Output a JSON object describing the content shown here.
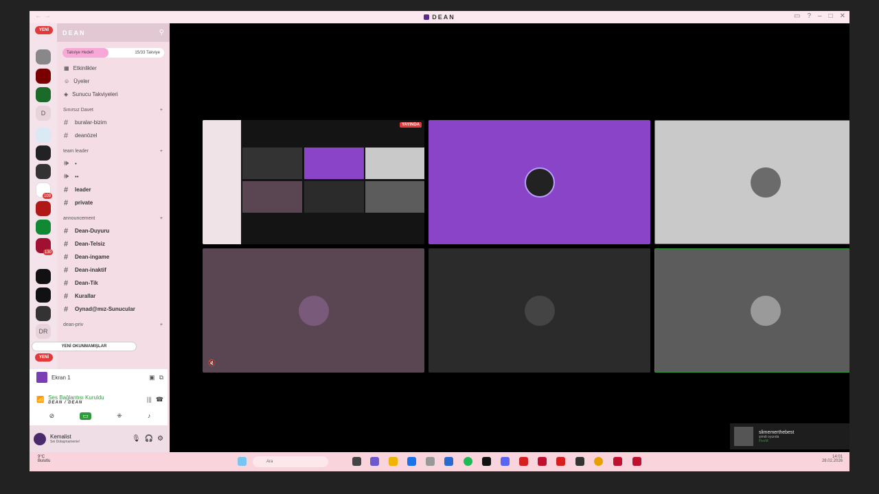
{
  "window": {
    "title": "DEAN"
  },
  "guilds": {
    "new_badge": "YENİ",
    "letters": [
      "D",
      "DR"
    ],
    "badges": [
      "109",
      "130"
    ]
  },
  "server": {
    "name": "DEAN",
    "boost_label": "Takviye Hedefi",
    "boost_count": "15/33 Takviye",
    "boost_progress": 0.45
  },
  "nav": [
    "Etkinlikler",
    "Üyeler",
    "Sunucu Takviyeleri"
  ],
  "categories": [
    {
      "label": "Sınırsız Davet",
      "channels": [
        "buralar-bizim",
        "deanözel"
      ]
    },
    {
      "label": "team leader",
      "channels": [
        "•",
        "••",
        "leader",
        "private"
      ]
    },
    {
      "label": "announcement",
      "channels": [
        "Dean-Duyuru",
        "Dean-Telsiz",
        "Dean-ingame",
        "Dean-inaktif",
        "Dean-Tik",
        "Kurallar",
        "Oynad@mız-Sunucular"
      ]
    },
    {
      "label": "dean-priv",
      "channels": []
    }
  ],
  "unread_pill": "YENİ OKUNMAMIŞLAR",
  "voice": {
    "screen_label": "Ekran 1",
    "status": "Ses Bağlantısı Kuruldu",
    "channel": "DEAN / DEAN"
  },
  "user": {
    "name": "Kemalist",
    "status": "Sei Dolaşmamenie!"
  },
  "stage": {
    "live_badge": "YAYINDA",
    "tile_colors": [
      "#1a1a1a",
      "#8a44c8",
      "#c9c9c9",
      "#5a4652",
      "#2b2b2b",
      "#5c5c5c"
    ]
  },
  "toast": {
    "name": "slimemerthebest",
    "line1": "şimdi oyunda",
    "line2": "FiveM"
  },
  "taskbar": {
    "search": "Ara",
    "time": "14:01",
    "date": "28.02.2026",
    "weather": "9°C",
    "weather_sub": "Bulutlu"
  }
}
